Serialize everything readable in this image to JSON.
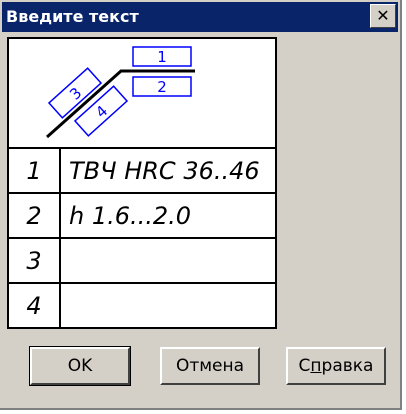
{
  "window": {
    "title": "Введите текст",
    "close_glyph": "✕"
  },
  "diagram": {
    "box_labels": [
      "1",
      "2",
      "3",
      "4"
    ],
    "accent": "#0000ff"
  },
  "rows": [
    {
      "num": "1",
      "value": "ТВЧ HRC 36..46"
    },
    {
      "num": "2",
      "value": "h 1.6...2.0"
    },
    {
      "num": "3",
      "value": ""
    },
    {
      "num": "4",
      "value": ""
    }
  ],
  "buttons": {
    "ok": "OK",
    "cancel": "Отмена",
    "help_prefix": "С",
    "help_mnemonic": "п",
    "help_suffix": "равка"
  }
}
